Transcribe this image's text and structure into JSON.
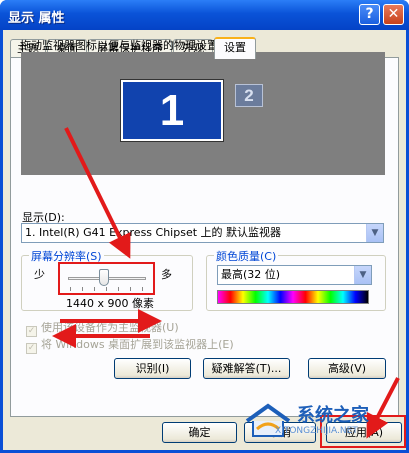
{
  "window": {
    "title": "显示 属性",
    "help_label": "?",
    "close_label": "✕"
  },
  "tabs": [
    {
      "label": "主题",
      "active": false
    },
    {
      "label": "桌面",
      "active": false
    },
    {
      "label": "屏幕保护程序",
      "active": false
    },
    {
      "label": "外观",
      "active": false
    },
    {
      "label": "设置",
      "active": true
    }
  ],
  "settings": {
    "description": "拖动监视器图标以便与监视器的物理设置匹配。",
    "monitor_primary": "1",
    "monitor_secondary": "2",
    "display_label": "显示(D):",
    "display_value": "1. Intel(R) G41 Express Chipset 上的 默认监视器",
    "resolution": {
      "title": "屏幕分辨率(S)",
      "less_label": "少",
      "more_label": "多",
      "value_text": "1440 x 900 像素",
      "slider_level_percent": 50
    },
    "color_quality": {
      "title": "颜色质量(C)",
      "value": "最高(32 位)"
    },
    "checkbox_primary": {
      "label": "使用该设备作为主监视器(U)",
      "checked": true,
      "enabled": false
    },
    "checkbox_extend": {
      "label": "将 Windows 桌面扩展到该监视器上(E)",
      "checked": true,
      "enabled": false
    },
    "buttons": {
      "identify": "识别(I)",
      "troubleshoot": "疑难解答(T)...",
      "advanced": "高级(V)"
    }
  },
  "footer": {
    "ok": "确定",
    "cancel": "取消",
    "apply": "应用(A)"
  },
  "watermark": {
    "text": "系统之家",
    "sub": "XITONGZHIJIA.NET"
  },
  "colors": {
    "title_bar": "#0a53d8",
    "annotation": "#e21a1a",
    "group_title": "#0046d5"
  }
}
